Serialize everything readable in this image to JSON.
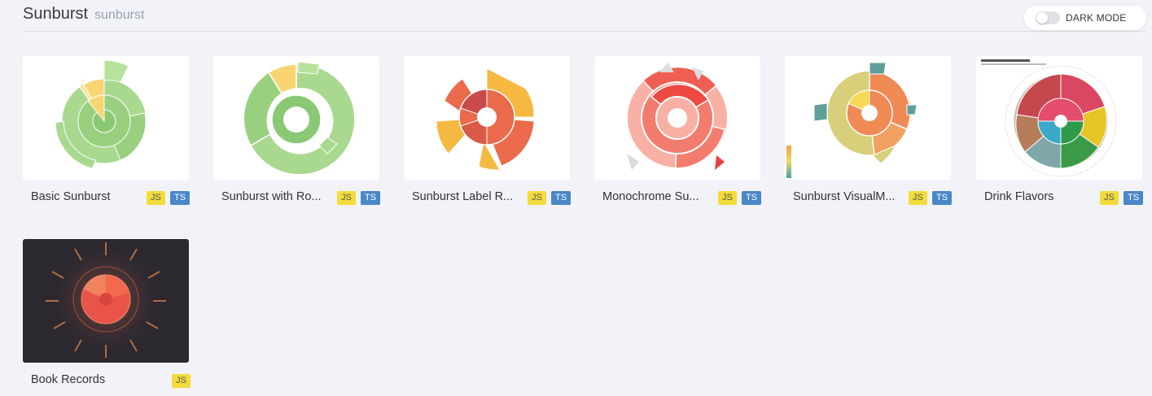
{
  "header": {
    "title": "Sunburst",
    "subtitle": "sunburst",
    "dark_mode_label": "DARK MODE"
  },
  "cards": [
    {
      "name": "Basic Sunburst",
      "badge_js": "JS",
      "badge_ts": "TS"
    },
    {
      "name": "Sunburst with Ro...",
      "badge_js": "JS",
      "badge_ts": "TS"
    },
    {
      "name": "Sunburst Label R...",
      "badge_js": "JS",
      "badge_ts": "TS"
    },
    {
      "name": "Monochrome Su...",
      "badge_js": "JS",
      "badge_ts": "TS"
    },
    {
      "name": "Sunburst VisualM...",
      "badge_js": "JS",
      "badge_ts": "TS"
    },
    {
      "name": "Drink Flavors",
      "badge_js": "JS",
      "badge_ts": "TS"
    },
    {
      "name": "Book Records",
      "badge_js": "JS"
    }
  ],
  "colors": {
    "page_background": "#f2f3f8",
    "js_badge": "#f3db3a",
    "ts_badge": "#4a87c7",
    "dark_thumb": "#2b2830"
  }
}
